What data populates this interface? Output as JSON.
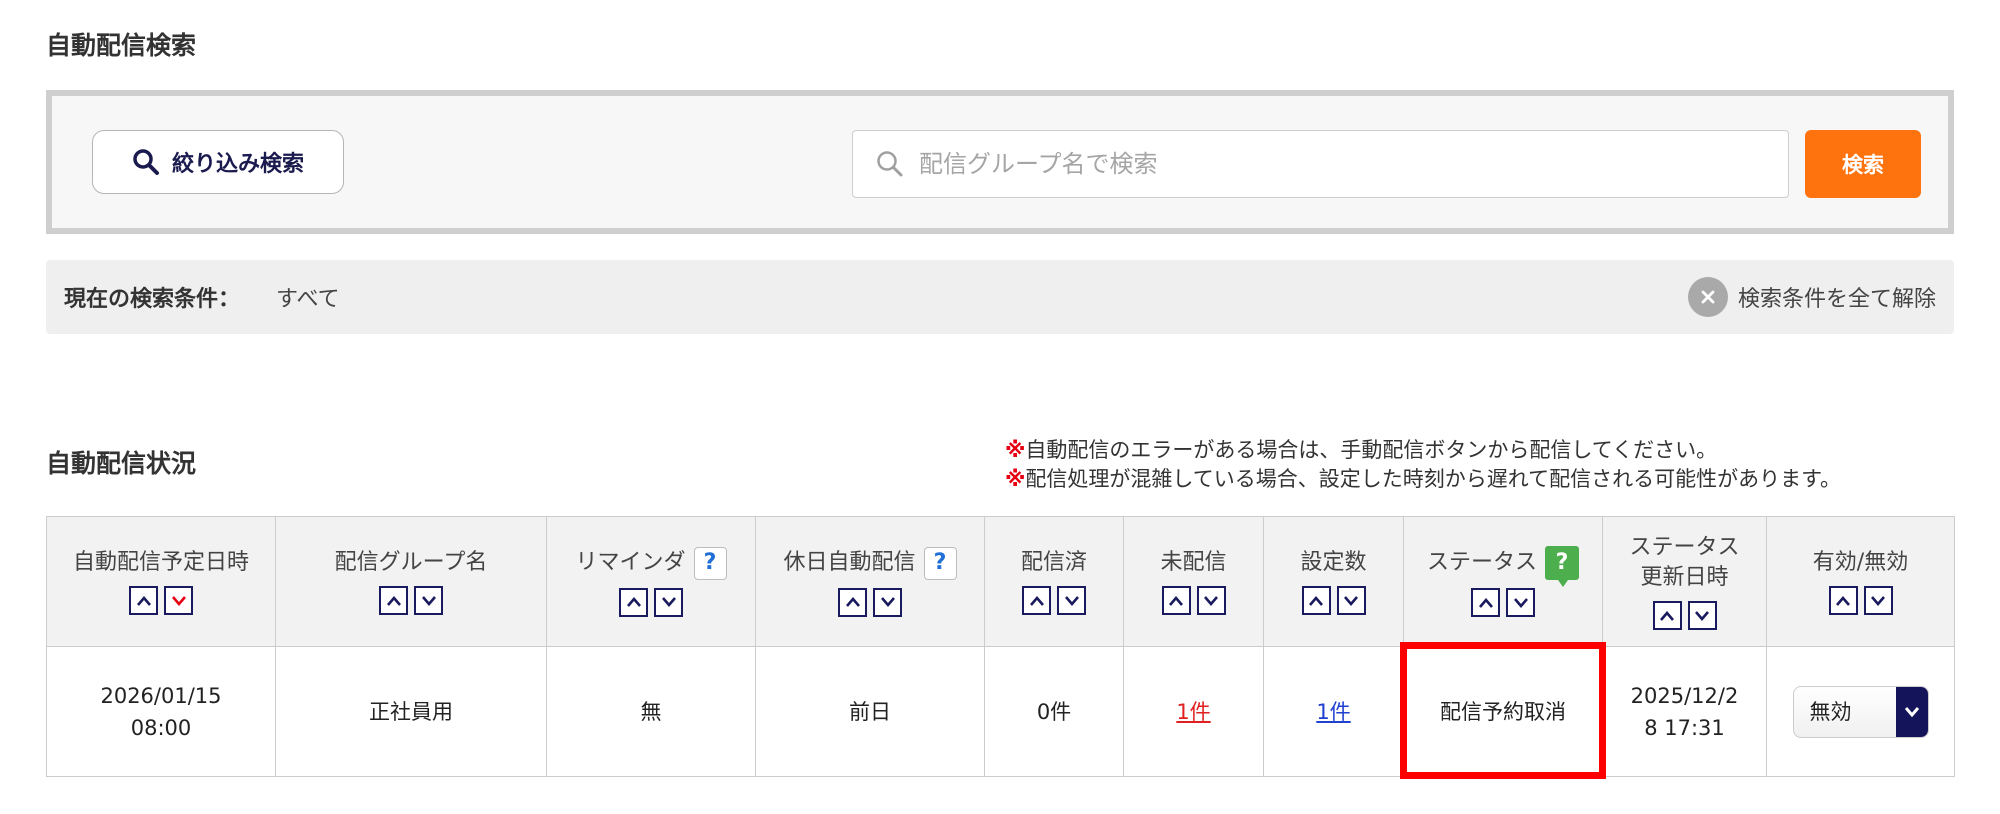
{
  "sections": {
    "search_title": "自動配信検索",
    "status_title": "自動配信状況"
  },
  "search": {
    "filter_button_label": "絞り込み検索",
    "placeholder": "配信グループ名で検索",
    "value": "",
    "search_button_label": "検索"
  },
  "condition": {
    "label": "現在の検索条件：",
    "value": "すべて",
    "clear_label": "検索条件を全て解除"
  },
  "notes": [
    {
      "mark": "※",
      "text": "自動配信のエラーがある場合は、手動配信ボタンから配信してください。"
    },
    {
      "mark": "※",
      "text": "配信処理が混雑している場合、設定した時刻から遅れて配信される可能性があります。"
    }
  ],
  "table": {
    "headers": {
      "schedule": "自動配信予定日時",
      "group": "配信グループ名",
      "reminder": "リマインダ",
      "holiday": "休日自動配信",
      "sent": "配信済",
      "unsent": "未配信",
      "count": "設定数",
      "status": "ステータス",
      "updated_line1": "ステータス",
      "updated_line2": "更新日時",
      "enabled": "有効/無効"
    },
    "help_mark": "?",
    "rows": [
      {
        "schedule_line1": "2026/01/15",
        "schedule_line2": "08:00",
        "group": "正社員用",
        "reminder": "無",
        "holiday": "前日",
        "sent": "0件",
        "unsent": "1件",
        "count": "1件",
        "status": "配信予約取消",
        "updated_line1": "2025/12/2",
        "updated_line2": "8 17:31",
        "enabled": "無効"
      }
    ]
  },
  "colors": {
    "accent_orange": "#ff730f",
    "navy": "#1a1a5e",
    "highlight_red": "#ff0000",
    "help_green": "#4cae4c",
    "link_red": "#e02020",
    "link_blue": "#2040d0",
    "active_sort_red": "#e60012"
  }
}
